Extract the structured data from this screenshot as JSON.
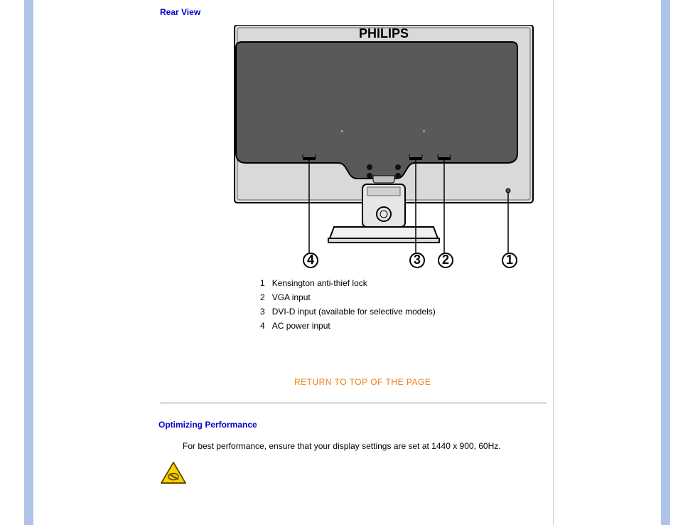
{
  "rear_view": {
    "title": "Rear View",
    "brand": "PHILIPS",
    "callouts": {
      "n1": "1",
      "n2": "2",
      "n3": "3",
      "n4": "4"
    },
    "legend": [
      {
        "num": "1",
        "text": "Kensington anti-thief lock"
      },
      {
        "num": "2",
        "text": "VGA input"
      },
      {
        "num": "3",
        "text": "DVI-D input (available for selective models)"
      },
      {
        "num": "4",
        "text": "AC power input"
      }
    ]
  },
  "return_link": "RETURN TO TOP OF THE PAGE",
  "perf": {
    "title": "Optimizing Performance",
    "text": "For best performance, ensure that your display settings are set at 1440 x 900, 60Hz."
  }
}
